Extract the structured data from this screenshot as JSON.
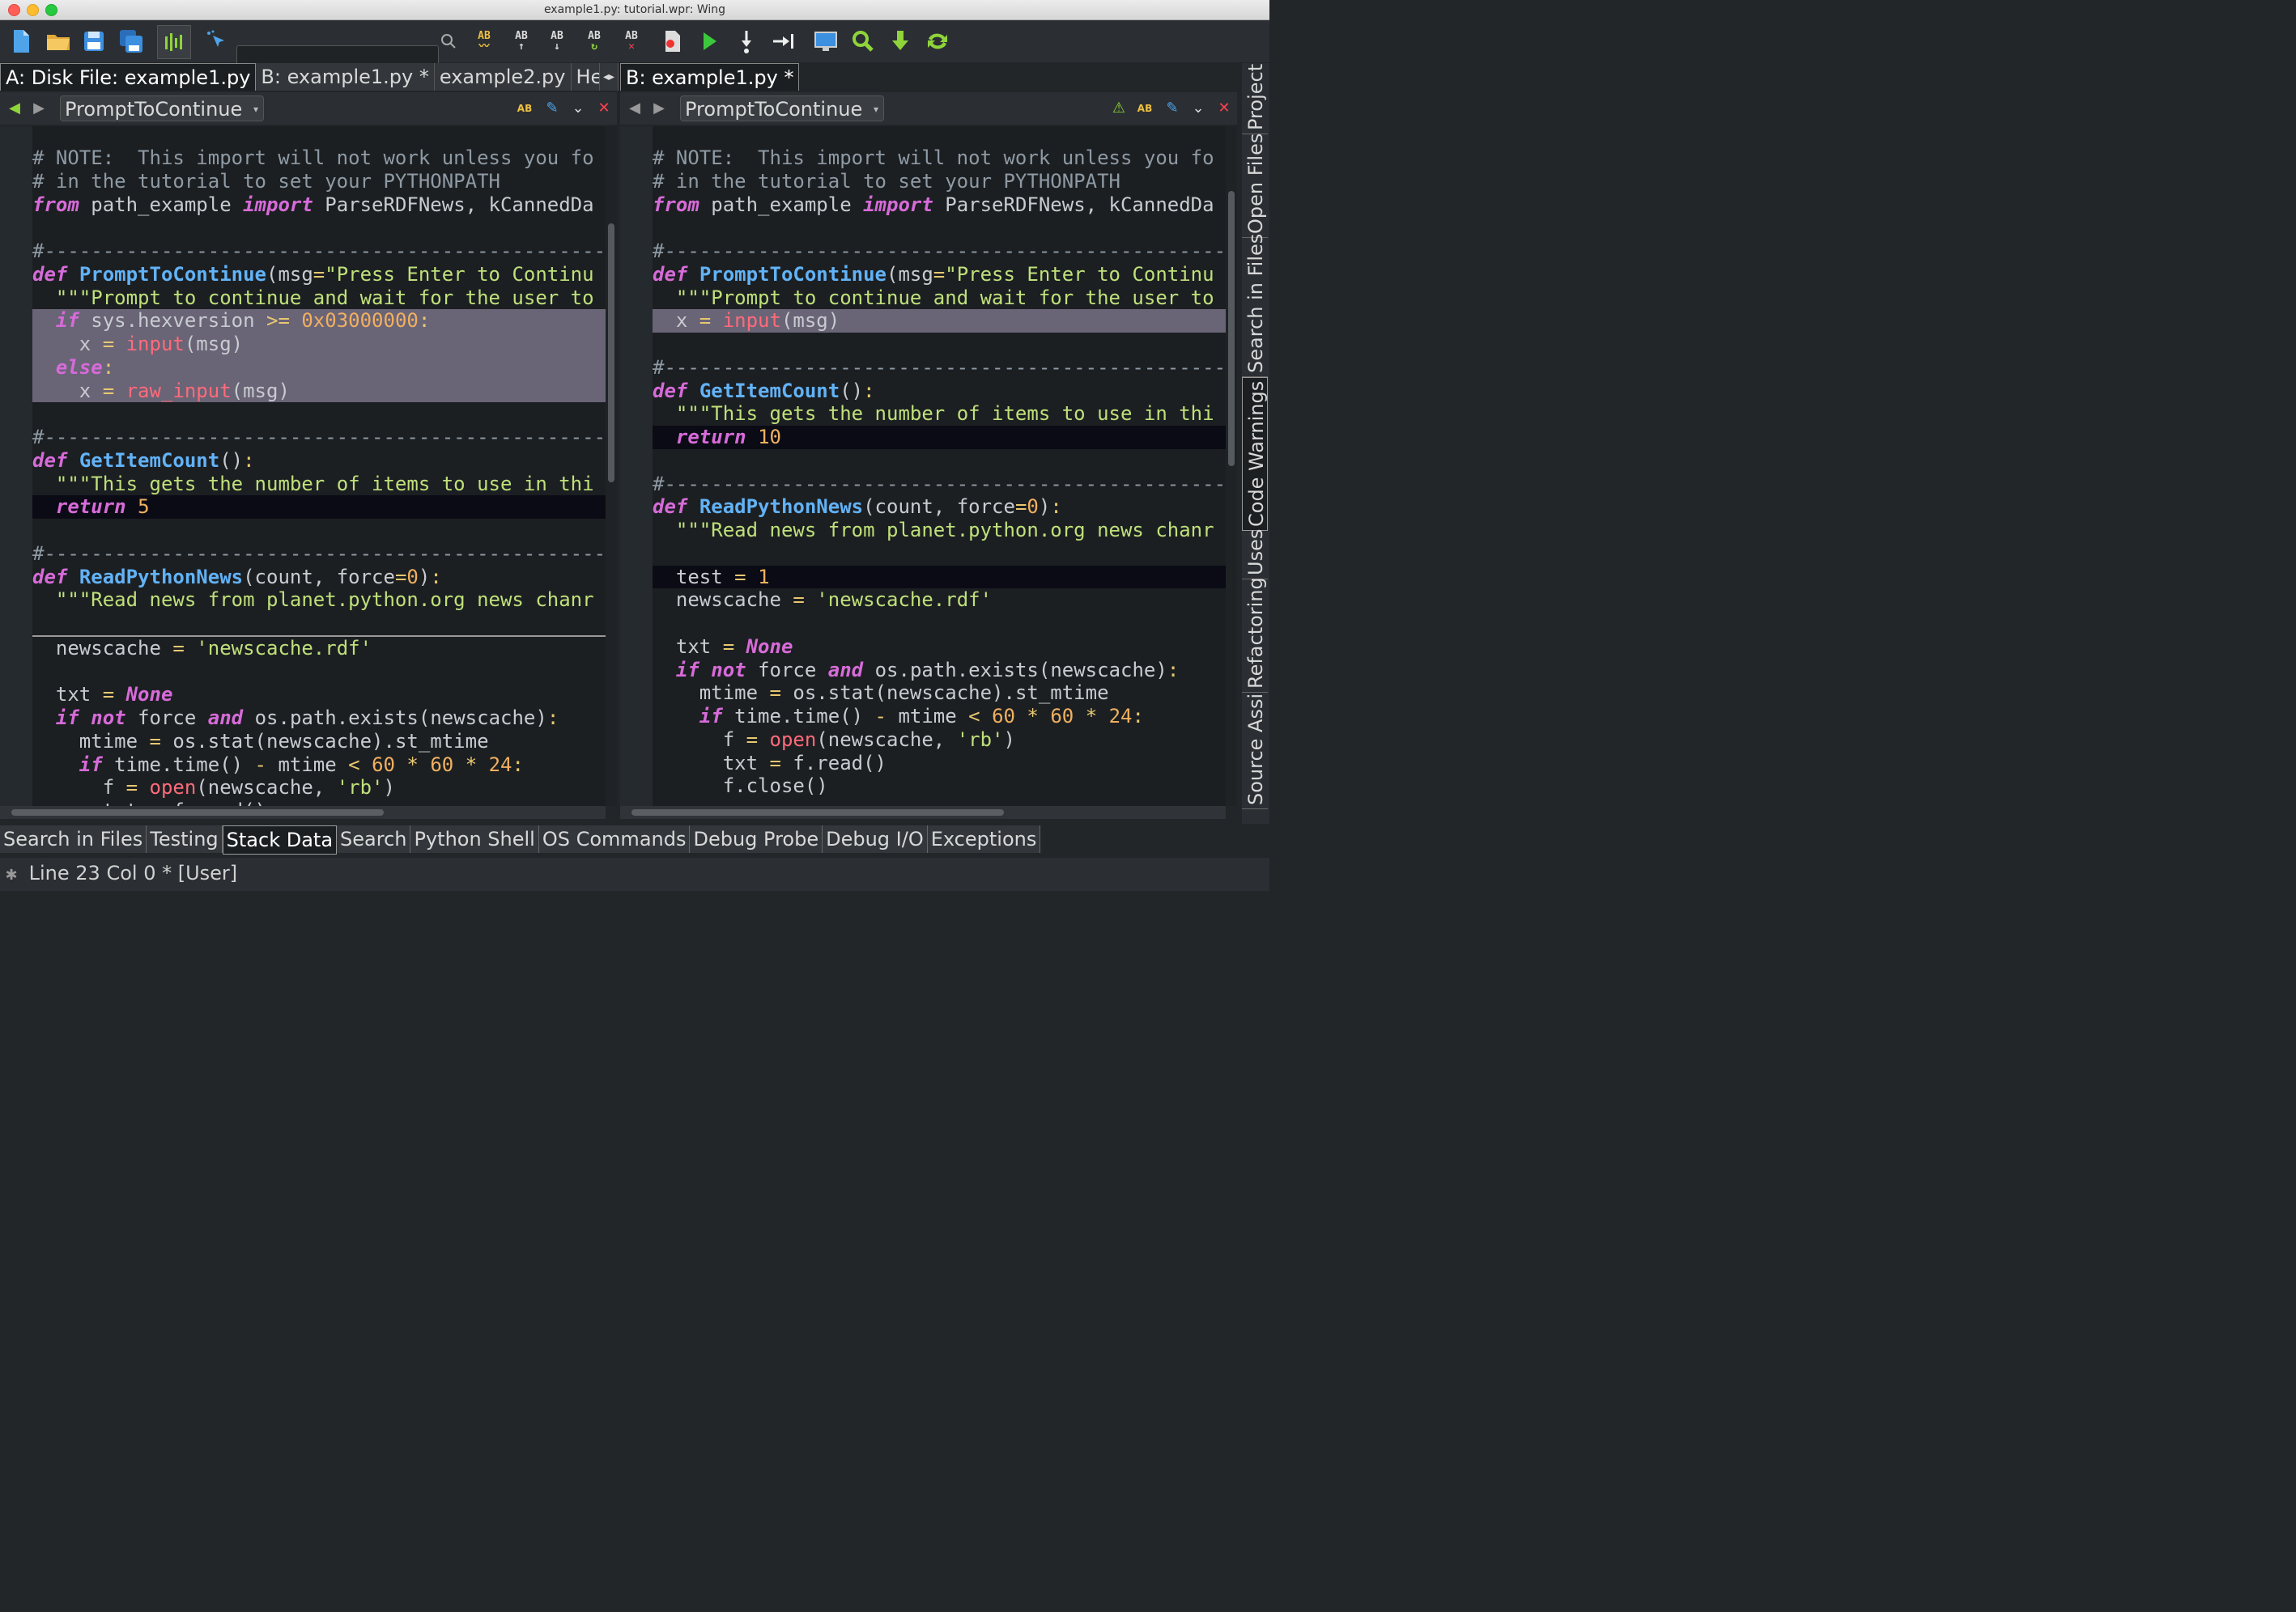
{
  "window": {
    "title": "example1.py: tutorial.wpr: Wing"
  },
  "toolbar": {
    "search_value": "",
    "icons": [
      "new-file-icon",
      "open-folder-icon",
      "save-icon",
      "save-all-icon",
      "indent-icon",
      "pointer-icon",
      "search-icon",
      "spell-check-icon",
      "find-up-icon",
      "find-down-icon",
      "replace-icon",
      "clear-icon",
      "debug-file-icon",
      "run-icon",
      "step-into-icon",
      "step-out-icon",
      "debug-monitor-icon",
      "zoom-icon",
      "download-icon",
      "refresh-icon"
    ]
  },
  "left": {
    "tabs": [
      "A: Disk File: example1.py",
      "B: example1.py *",
      "example2.py",
      "Help"
    ],
    "scope": "PromptToContinue",
    "lines": [
      "# NOTE:  This import will not work unless you fo",
      "# in the tutorial to set your PYTHONPATH",
      "from path_example import ParseRDFNews, kCannedDa",
      "",
      "#----------------------------------------------------",
      "def PromptToContinue(msg=\"Press Enter to Continu",
      "  \"\"\"Prompt to continue and wait for the user to",
      "  if sys.hexversion >= 0x03000000:",
      "    x = input(msg)",
      "  else:",
      "    x = raw_input(msg)",
      "",
      "#----------------------------------------------------",
      "def GetItemCount():",
      "  \"\"\"This gets the number of items to use in thi",
      "  return 5",
      "",
      "#----------------------------------------------------",
      "def ReadPythonNews(count, force=0):",
      "  \"\"\"Read news from planet.python.org news chanr",
      "",
      "  newscache = 'newscache.rdf'",
      "",
      "  txt = None",
      "  if not force and os.path.exists(newscache):",
      "    mtime = os.stat(newscache).st_mtime",
      "    if time.time() - mtime < 60 * 60 * 24:",
      "      f = open(newscache, 'rb')",
      "      txt = f.read()"
    ]
  },
  "right": {
    "tabs": [
      "B: example1.py *"
    ],
    "scope": "PromptToContinue",
    "lines": [
      "# NOTE:  This import will not work unless you fo",
      "# in the tutorial to set your PYTHONPATH",
      "from path_example import ParseRDFNews, kCannedDa",
      "",
      "#----------------------------------------------------",
      "def PromptToContinue(msg=\"Press Enter to Continu",
      "  \"\"\"Prompt to continue and wait for the user to",
      "  x = input(msg)",
      "",
      "#----------------------------------------------------",
      "def GetItemCount():",
      "  \"\"\"This gets the number of items to use in thi",
      "  return 10",
      "",
      "#----------------------------------------------------",
      "def ReadPythonNews(count, force=0):",
      "  \"\"\"Read news from planet.python.org news chanr",
      "",
      "  test = 1",
      "  newscache = 'newscache.rdf'",
      "",
      "  txt = None",
      "  if not force and os.path.exists(newscache):",
      "    mtime = os.stat(newscache).st_mtime",
      "    if time.time() - mtime < 60 * 60 * 24:",
      "      f = open(newscache, 'rb')",
      "      txt = f.read()",
      "      f.close()"
    ]
  },
  "side_tabs": [
    "Project",
    "Open Files",
    "Search in Files",
    "Code Warnings",
    "Uses",
    "Refactoring",
    "Source Assistant"
  ],
  "bottom_tabs": [
    "Search in Files",
    "Testing",
    "Stack Data",
    "Search",
    "Python Shell",
    "OS Commands",
    "Debug Probe",
    "Debug I/O",
    "Exceptions"
  ],
  "status": {
    "text": "Line 23 Col 0 * [User]"
  }
}
